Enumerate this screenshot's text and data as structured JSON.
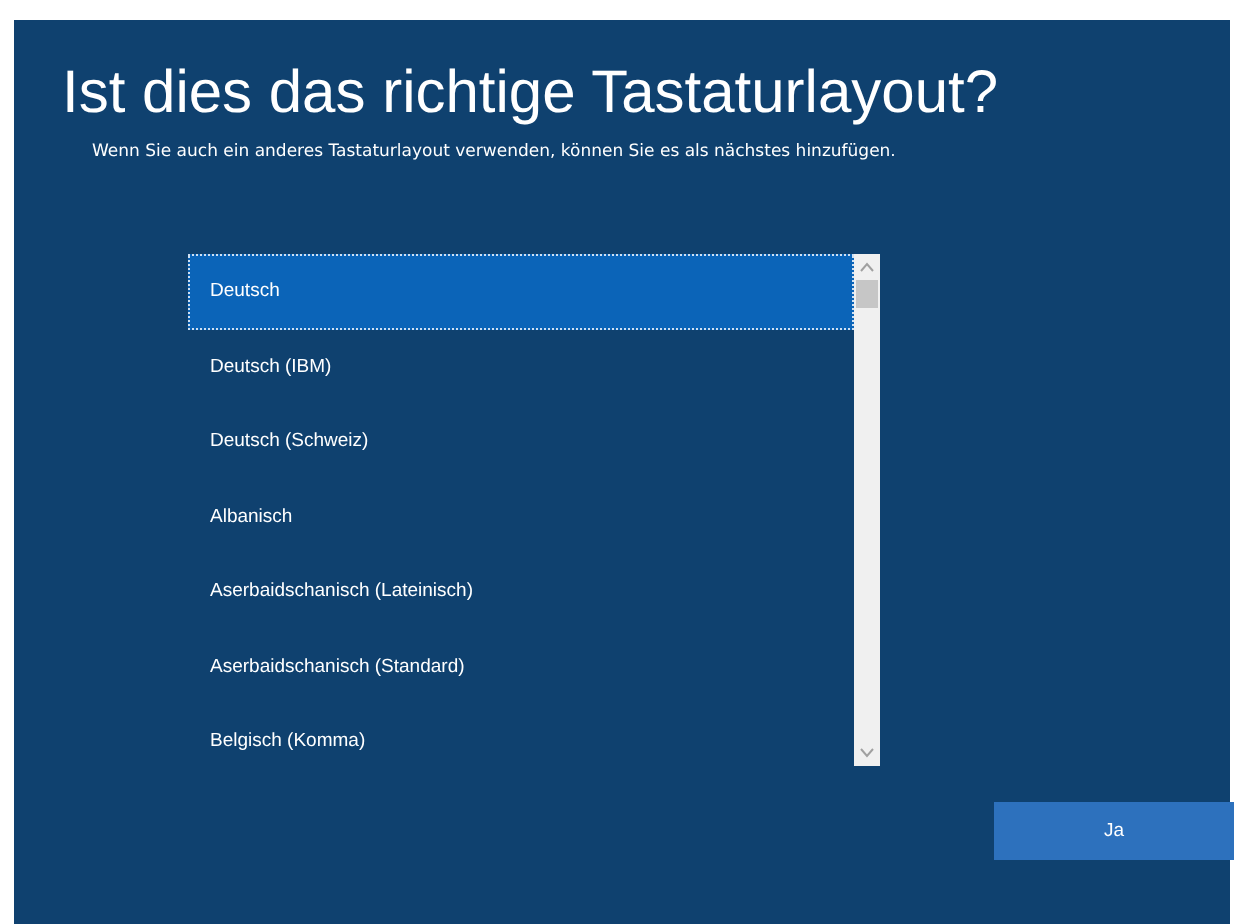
{
  "title": "Ist dies das richtige Tastaturlayout?",
  "subtitle": "Wenn Sie auch ein anderes Tastaturlayout verwenden, können Sie es als nächstes hinzufügen.",
  "layouts": [
    {
      "label": "Deutsch",
      "selected": true
    },
    {
      "label": "Deutsch (IBM)",
      "selected": false
    },
    {
      "label": "Deutsch (Schweiz)",
      "selected": false
    },
    {
      "label": "Albanisch",
      "selected": false
    },
    {
      "label": "Aserbaidschanisch (Lateinisch)",
      "selected": false
    },
    {
      "label": "Aserbaidschanisch (Standard)",
      "selected": false
    },
    {
      "label": "Belgisch (Komma)",
      "selected": false
    }
  ],
  "buttons": [
    "Ja"
  ]
}
